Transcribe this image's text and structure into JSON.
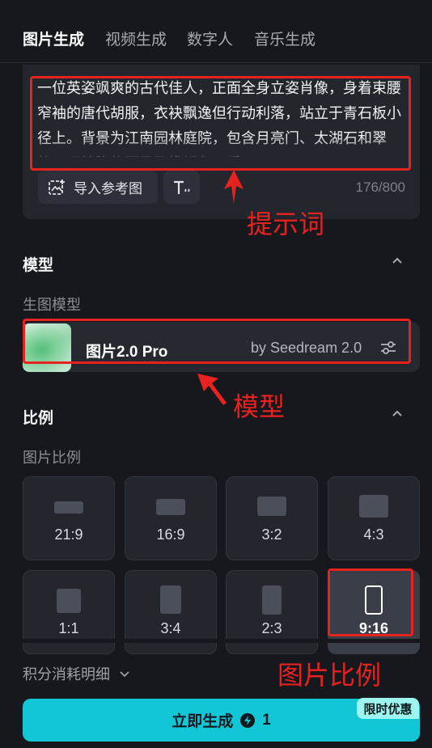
{
  "tabs": [
    {
      "label": "图片生成",
      "active": true
    },
    {
      "label": "视频生成",
      "active": false
    },
    {
      "label": "数字人",
      "active": false
    },
    {
      "label": "音乐生成",
      "active": false
    }
  ],
  "prompt": {
    "text": "一位英姿飒爽的古代佳人，正面全身立姿肖像，身着束腰窄袖的唐代胡服，衣袂飘逸但行动利落，站立于青石板小径上。背景为江南园林庭院，包含月亮门、太湖石和翠竹，远处隐约可见飞檐翘角，采",
    "import_button_label": "导入参考图",
    "counter": "176/800"
  },
  "model_section": {
    "title": "模型",
    "sub_label": "生图模型",
    "model_name": "图片2.0 Pro",
    "model_by": "by Seedream 2.0"
  },
  "ratio_section": {
    "title": "比例",
    "sub_label": "图片比例",
    "ratios": [
      {
        "label": "21:9",
        "selected": false
      },
      {
        "label": "16:9",
        "selected": false
      },
      {
        "label": "3:2",
        "selected": false
      },
      {
        "label": "4:3",
        "selected": false
      },
      {
        "label": "1:1",
        "selected": false
      },
      {
        "label": "3:4",
        "selected": false
      },
      {
        "label": "2:3",
        "selected": false
      },
      {
        "label": "9:16",
        "selected": true
      }
    ]
  },
  "credits_label": "积分消耗明细",
  "generate": {
    "label": "立即生成",
    "cost": "1",
    "promo_badge": "限时优惠"
  },
  "annotations": {
    "prompt_label": "提示词",
    "model_label": "模型",
    "ratio_label": "图片比例"
  },
  "colors": {
    "accent": "#12c6d6",
    "annotation": "#e8221f",
    "background": "#16181d"
  }
}
